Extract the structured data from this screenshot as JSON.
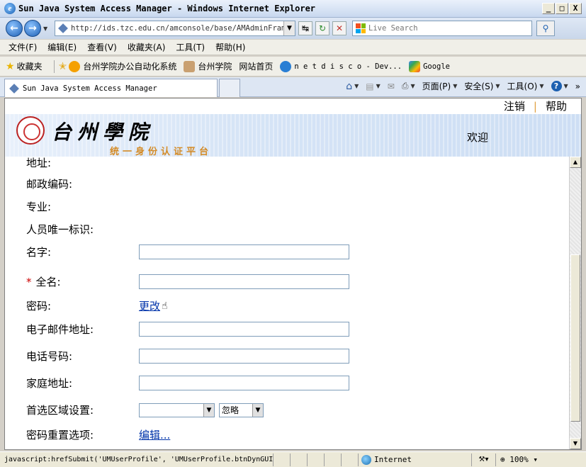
{
  "window": {
    "title": "Sun Java System Access Manager - Windows Internet Explorer",
    "minimize": "_",
    "maximize": "□",
    "close": "X"
  },
  "address_bar": {
    "url": "http://ids.tzc.edu.cn/amconsole/base/AMAdminFrame"
  },
  "search": {
    "placeholder": "Live Search"
  },
  "menu": [
    "文件(F)",
    "编辑(E)",
    "查看(V)",
    "收藏夹(A)",
    "工具(T)",
    "帮助(H)"
  ],
  "favorites": {
    "label": "收藏夹",
    "items": [
      "台州学院办公自动化系统",
      "台州学院",
      "网站首页",
      "n e t d i s c o - Dev...",
      "Google"
    ]
  },
  "tab": {
    "label": "Sun Java System Access Manager"
  },
  "command_bar": {
    "page": "页面(P)",
    "safety": "安全(S)",
    "tools": "工具(O)"
  },
  "header": {
    "logout": "注销",
    "help": "帮助",
    "college_name": "台州學院",
    "subtitle": "统一身份认证平台",
    "welcome": "欢迎"
  },
  "form": {
    "address_label": "地址:",
    "postal_label": "邮政编码:",
    "major_label": "专业:",
    "unique_id_label": "人员唯一标识:",
    "first_name_label": "名字:",
    "first_name_value": "",
    "required_mark": "*",
    "full_name_label": "全名:",
    "full_name_value": "",
    "password_label": "密码:",
    "password_link": "更改",
    "email_label": "电子邮件地址:",
    "email_value": "",
    "phone_label": "电话号码:",
    "phone_value": "",
    "home_label": "家庭地址:",
    "home_value": "",
    "locale_label": "首选区域设置:",
    "locale_value": "",
    "locale_option": "忽略",
    "reset_label": "密码重置选项:",
    "reset_link": "编辑..."
  },
  "status_bar": {
    "text": "javascript:hrefSubmit('UMUserProfile', 'UMUserProfile.btnDynGUIL",
    "zone": "Internet",
    "zoom": "100%"
  }
}
